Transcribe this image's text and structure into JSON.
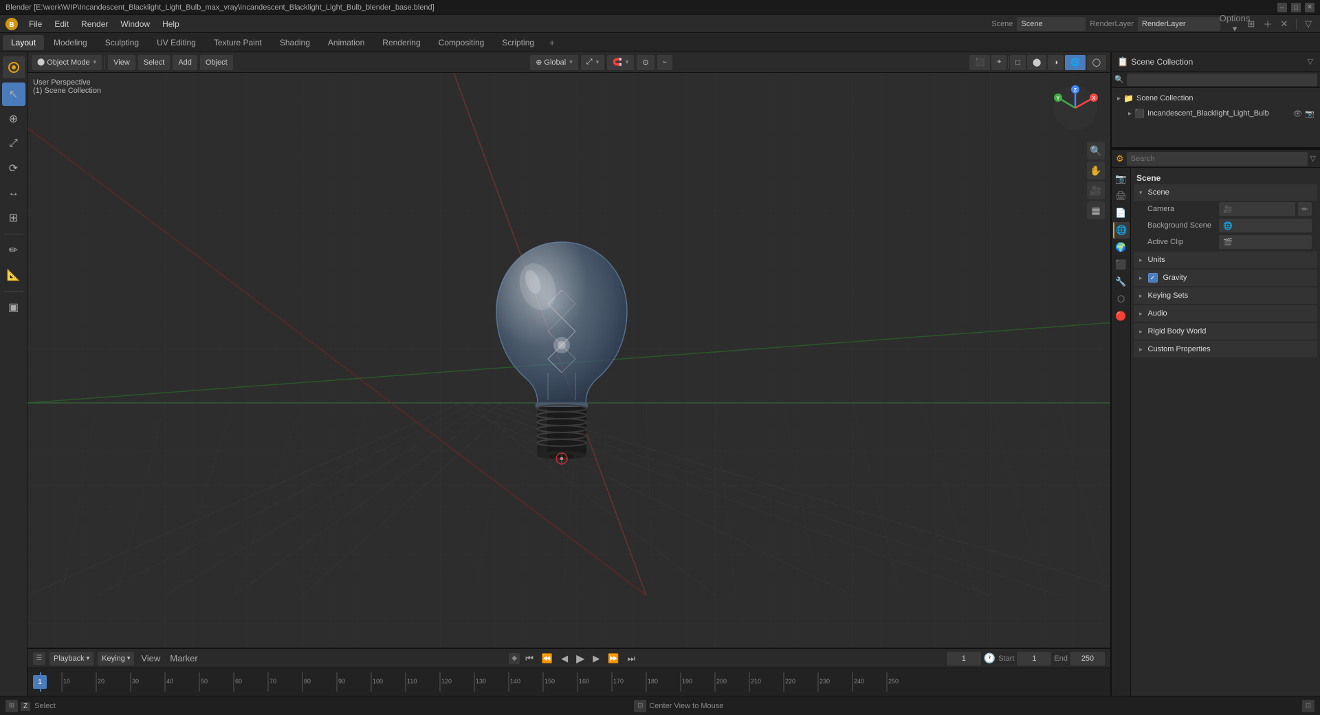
{
  "titleBar": {
    "title": "Blender [E:\\work\\WIP\\Incandescent_Blacklight_Light_Bulb_max_vray\\Incandescent_Blacklight_Light_Bulb_blender_base.blend]",
    "minimize": "─",
    "maximize": "□",
    "close": "✕"
  },
  "menuBar": {
    "items": [
      "Blender",
      "File",
      "Edit",
      "Render",
      "Window",
      "Help"
    ]
  },
  "workspaceTabs": {
    "tabs": [
      "Layout",
      "Modeling",
      "Sculpting",
      "UV Editing",
      "Texture Paint",
      "Shading",
      "Animation",
      "Rendering",
      "Compositing",
      "Scripting"
    ],
    "activeTab": "Layout",
    "addLabel": "+"
  },
  "viewportHeader": {
    "modeLabel": "Object Mode",
    "modeArrow": "▾",
    "viewLabel": "View",
    "selectLabel": "Select",
    "addLabel": "Add",
    "objectLabel": "Object",
    "globalLabel": "Global",
    "globalArrow": "▾",
    "transformArrow": "▾",
    "snapArrow": "▾",
    "proportionalArrow": "▾"
  },
  "viewport": {
    "perspLabel": "User Perspective",
    "collectionLabel": "(1) Scene Collection"
  },
  "tools": {
    "leftTools": [
      "↖",
      "⟳",
      "↔",
      "⊕",
      "⤢",
      "✏",
      "📐",
      "▣"
    ]
  },
  "rightViewportTools": [
    "🔍",
    "✋",
    "🎥",
    "▦"
  ],
  "gizmo": {
    "xLabel": "X",
    "yLabel": "Y",
    "zLabel": "Z"
  },
  "outliner": {
    "header": "Scene Collection",
    "searchPlaceholder": "",
    "items": [
      {
        "indent": 0,
        "icon": "▸",
        "name": "Scene Collection",
        "extra": ""
      },
      {
        "indent": 1,
        "icon": "▸",
        "name": "Incandescent_Blacklight_Light_Bulb",
        "extra": "👁 📷"
      }
    ]
  },
  "propertiesHeader": {
    "searchPlaceholder": "Search"
  },
  "propertiesTabs": [
    {
      "icon": "📷",
      "label": "render",
      "active": false
    },
    {
      "icon": "⚙",
      "label": "output",
      "active": false
    },
    {
      "icon": "📄",
      "label": "view-layer",
      "active": false
    },
    {
      "icon": "🌐",
      "label": "scene",
      "active": true
    },
    {
      "icon": "🌍",
      "label": "world",
      "active": false
    },
    {
      "icon": "⬛",
      "label": "object",
      "active": false
    },
    {
      "icon": "🔧",
      "label": "modifier",
      "active": false
    },
    {
      "icon": "⬡",
      "label": "particles",
      "active": false
    },
    {
      "icon": "🔴",
      "label": "physics",
      "active": false
    }
  ],
  "propertiesSections": {
    "sceneName": "Scene",
    "sections": [
      {
        "name": "Scene",
        "expanded": true,
        "rows": [
          {
            "label": "Camera",
            "value": ""
          },
          {
            "label": "Background Scene",
            "value": ""
          },
          {
            "label": "Active Clip",
            "value": ""
          }
        ]
      },
      {
        "name": "Units",
        "expanded": false,
        "rows": []
      },
      {
        "name": "Gravity",
        "expanded": false,
        "hasCheckbox": true,
        "checked": true,
        "rows": []
      },
      {
        "name": "Keying Sets",
        "expanded": false,
        "rows": []
      },
      {
        "name": "Audio",
        "expanded": false,
        "rows": []
      },
      {
        "name": "Rigid Body World",
        "expanded": false,
        "rows": []
      },
      {
        "name": "Custom Properties",
        "expanded": false,
        "rows": []
      }
    ]
  },
  "timeline": {
    "playbackLabel": "Playback",
    "keyingLabel": "Keying",
    "viewLabel": "View",
    "markerLabel": "Marker",
    "currentFrame": "1",
    "startFrame": "1",
    "endFrame": "250",
    "startLabel": "Start",
    "endLabel": "End",
    "frameMarks": [
      "1",
      "10",
      "20",
      "30",
      "40",
      "50",
      "60",
      "70",
      "80",
      "90",
      "100",
      "110",
      "120",
      "130",
      "140",
      "150",
      "160",
      "170",
      "180",
      "190",
      "200",
      "210",
      "220",
      "230",
      "240",
      "250"
    ]
  },
  "statusBar": {
    "selectLabel": "Select",
    "centerLabel": "Center View to Mouse",
    "selectKey": "Z",
    "centerKey": "..."
  },
  "colors": {
    "accent": "#e6a00d",
    "activeBlue": "#4a7cbc",
    "bgDark": "#1a1a1a",
    "bgMid": "#2a2a2a",
    "bgLight": "#333333",
    "gridRed": "#7a3333",
    "gridGreen": "#3a6a3a"
  }
}
